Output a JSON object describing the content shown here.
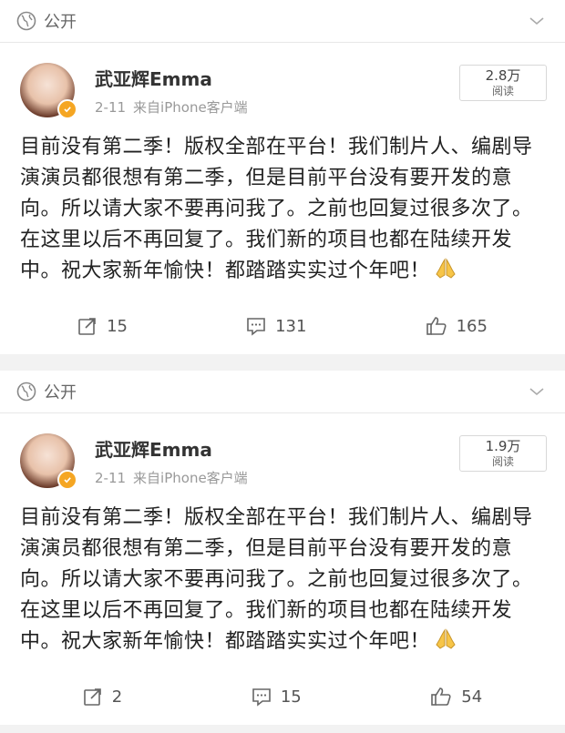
{
  "posts": [
    {
      "visibility": "公开",
      "author": "武亚辉Emma",
      "date": "2-11",
      "source": "来自iPhone客户端",
      "read_count": "2.8万",
      "read_label": "阅读",
      "content": "目前没有第二季！版权全部在平台！我们制片人、编剧导演演员都很想有第二季，但是目前平台没有要开发的意向。所以请大家不要再问我了。之前也回复过很多次了。在这里以后不再回复了。我们新的项目也都在陆续开发中。祝大家新年愉快！都踏踏实实过个年吧！",
      "emoji": "folded-hands-icon",
      "reposts": "15",
      "comments": "131",
      "likes": "165"
    },
    {
      "visibility": "公开",
      "author": "武亚辉Emma",
      "date": "2-11",
      "source": "来自iPhone客户端",
      "read_count": "1.9万",
      "read_label": "阅读",
      "content": "目前没有第二季！版权全部在平台！我们制片人、编剧导演演员都很想有第二季，但是目前平台没有要开发的意向。所以请大家不要再问我了。之前也回复过很多次了。在这里以后不再回复了。我们新的项目也都在陆续开发中。祝大家新年愉快！都踏踏实实过个年吧！",
      "emoji": "folded-hands-icon",
      "reposts": "2",
      "comments": "15",
      "likes": "54"
    }
  ],
  "colors": {
    "verified_badge": "#f5a623",
    "text": "#222222",
    "meta": "#999999",
    "background": "#f2f2f2"
  }
}
